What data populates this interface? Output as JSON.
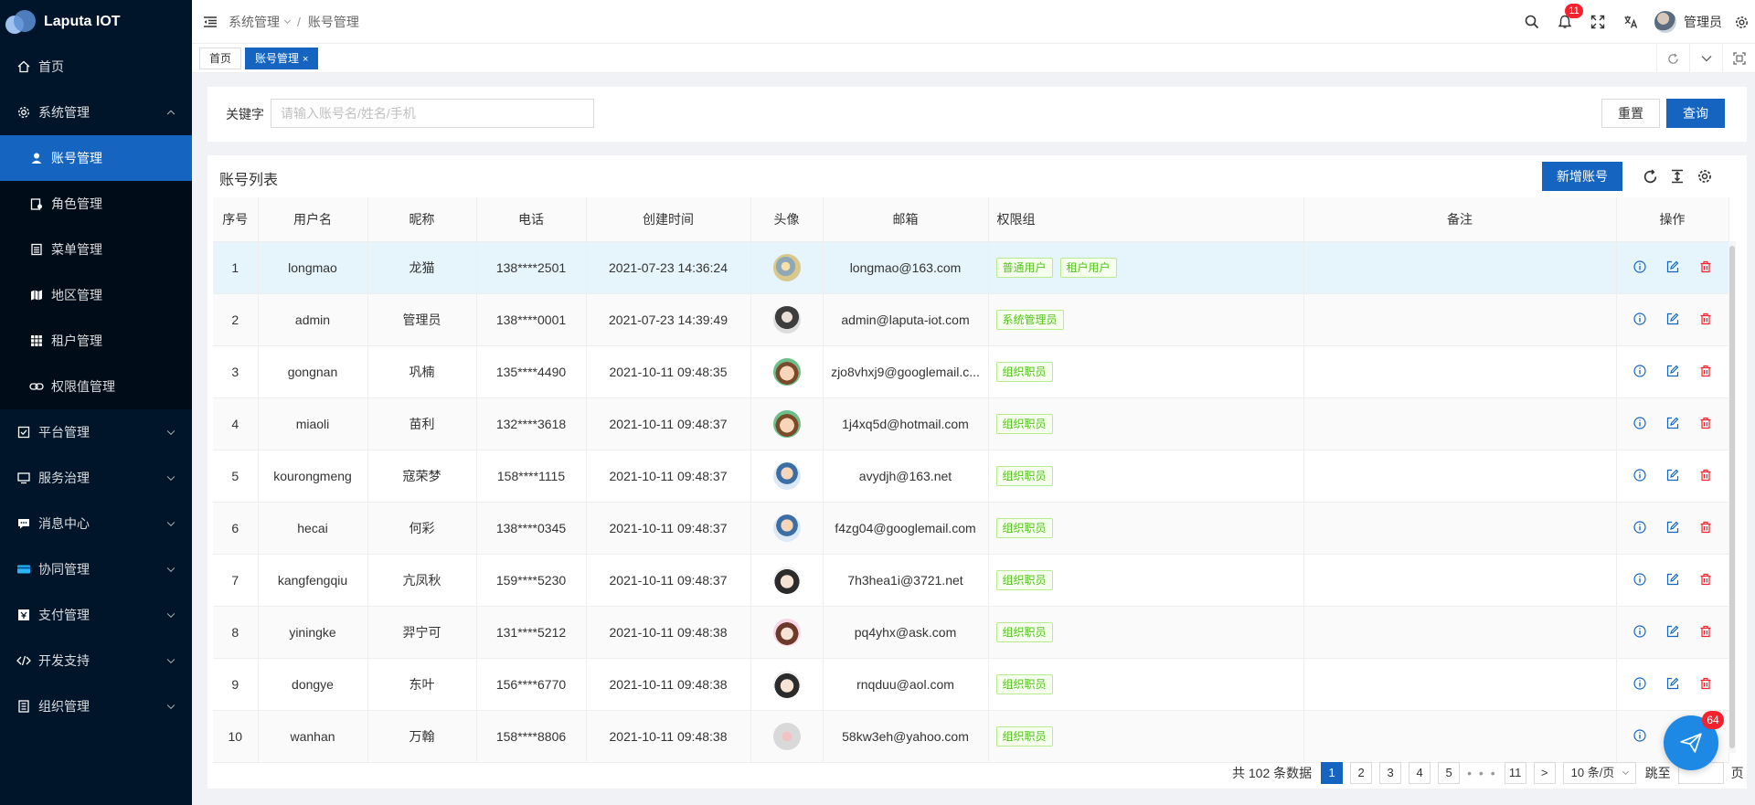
{
  "app": {
    "title": "Laputa IOT"
  },
  "sidebar": {
    "items": [
      {
        "label": "首页",
        "icon": "home-icon"
      },
      {
        "label": "系统管理",
        "icon": "gear-icon",
        "expanded": true,
        "children": [
          {
            "label": "账号管理",
            "icon": "user-icon",
            "active": true
          },
          {
            "label": "角色管理",
            "icon": "role-icon"
          },
          {
            "label": "菜单管理",
            "icon": "menu-icon"
          },
          {
            "label": "地区管理",
            "icon": "map-icon"
          },
          {
            "label": "租户管理",
            "icon": "grid-icon"
          },
          {
            "label": "权限值管理",
            "icon": "link-icon"
          }
        ]
      },
      {
        "label": "平台管理",
        "icon": "check-square-icon"
      },
      {
        "label": "服务治理",
        "icon": "monitor-icon"
      },
      {
        "label": "消息中心",
        "icon": "message-icon"
      },
      {
        "label": "协同管理",
        "icon": "card-icon"
      },
      {
        "label": "支付管理",
        "icon": "pay-icon"
      },
      {
        "label": "开发支持",
        "icon": "code-icon"
      },
      {
        "label": "组织管理",
        "icon": "org-icon"
      }
    ]
  },
  "header": {
    "breadcrumb": [
      "系统管理",
      "账号管理"
    ],
    "notification_count": "11",
    "user_name": "管理员"
  },
  "tabs": [
    {
      "label": "首页",
      "active": false
    },
    {
      "label": "账号管理",
      "active": true,
      "close": "×"
    }
  ],
  "search": {
    "label": "关键字",
    "placeholder": "请输入账号名/姓名/手机",
    "value": "",
    "reset_label": "重置",
    "query_label": "查询"
  },
  "table": {
    "title": "账号列表",
    "add_label": "新增账号",
    "columns": [
      "序号",
      "用户名",
      "昵称",
      "电话",
      "创建时间",
      "头像",
      "邮箱",
      "权限组",
      "备注",
      "操作"
    ],
    "rows": [
      {
        "no": "1",
        "username": "longmao",
        "nickname": "龙猫",
        "phone": "138****2501",
        "created": "2021-07-23 14:36:24",
        "email": "longmao@163.com",
        "groups": [
          "普通用户",
          "租户用户"
        ],
        "note": ""
      },
      {
        "no": "2",
        "username": "admin",
        "nickname": "管理员",
        "phone": "138****0001",
        "created": "2021-07-23 14:39:49",
        "email": "admin@laputa-iot.com",
        "groups": [
          "系统管理员"
        ],
        "note": ""
      },
      {
        "no": "3",
        "username": "gongnan",
        "nickname": "巩楠",
        "phone": "135****4490",
        "created": "2021-10-11 09:48:35",
        "email": "zjo8vhxj9@googlemail.c...",
        "groups": [
          "组织职员"
        ],
        "note": ""
      },
      {
        "no": "4",
        "username": "miaoli",
        "nickname": "苗利",
        "phone": "132****3618",
        "created": "2021-10-11 09:48:37",
        "email": "1j4xq5d@hotmail.com",
        "groups": [
          "组织职员"
        ],
        "note": ""
      },
      {
        "no": "5",
        "username": "kourongmeng",
        "nickname": "寇荣梦",
        "phone": "158****1115",
        "created": "2021-10-11 09:48:37",
        "email": "avydjh@163.net",
        "groups": [
          "组织职员"
        ],
        "note": ""
      },
      {
        "no": "6",
        "username": "hecai",
        "nickname": "何彩",
        "phone": "138****0345",
        "created": "2021-10-11 09:48:37",
        "email": "f4zg04@googlemail.com",
        "groups": [
          "组织职员"
        ],
        "note": ""
      },
      {
        "no": "7",
        "username": "kangfengqiu",
        "nickname": "亢凤秋",
        "phone": "159****5230",
        "created": "2021-10-11 09:48:37",
        "email": "7h3hea1i@3721.net",
        "groups": [
          "组织职员"
        ],
        "note": ""
      },
      {
        "no": "8",
        "username": "yiningke",
        "nickname": "羿宁可",
        "phone": "131****5212",
        "created": "2021-10-11 09:48:38",
        "email": "pq4yhx@ask.com",
        "groups": [
          "组织职员"
        ],
        "note": ""
      },
      {
        "no": "9",
        "username": "dongye",
        "nickname": "东叶",
        "phone": "156****6770",
        "created": "2021-10-11 09:48:38",
        "email": "rnqduu@aol.com",
        "groups": [
          "组织职员"
        ],
        "note": ""
      },
      {
        "no": "10",
        "username": "wanhan",
        "nickname": "万翰",
        "phone": "158****8806",
        "created": "2021-10-11 09:48:38",
        "email": "58kw3eh@yahoo.com",
        "groups": [
          "组织职员"
        ],
        "note": ""
      }
    ]
  },
  "pagination": {
    "total_text": "共 102 条数据",
    "pages": [
      "1",
      "2",
      "3",
      "4",
      "5"
    ],
    "dots": "• • •",
    "last_page": "11",
    "next": ">",
    "page_size": "10 条/页",
    "jump_label": "跳至",
    "page_suffix": "页"
  },
  "fab": {
    "badge": "64"
  },
  "colors": {
    "primary": "#1565c0",
    "sidebar_bg": "#001529",
    "tag_green": "#52c41a",
    "danger": "#f5222d"
  }
}
